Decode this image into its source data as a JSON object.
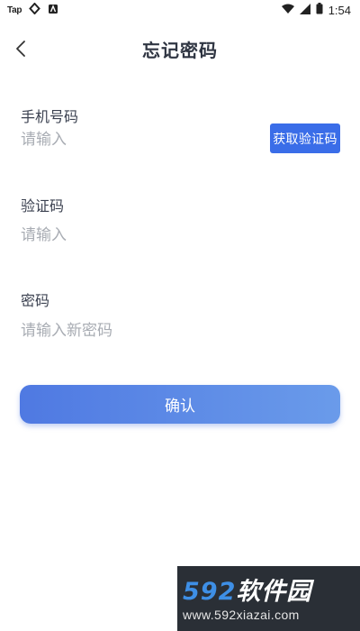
{
  "status_bar": {
    "left_label": "Tap",
    "time": "1:54"
  },
  "header": {
    "title": "忘记密码"
  },
  "form": {
    "phone": {
      "label": "手机号码",
      "placeholder": "请输入"
    },
    "get_code_button": "获取验证码",
    "code": {
      "label": "验证码",
      "placeholder": "请输入"
    },
    "password": {
      "label": "密码",
      "placeholder": "请输入新密码"
    },
    "confirm_button": "确认"
  },
  "watermark": {
    "number": "592",
    "text": "软件园",
    "url": "www.592xiazai.com"
  },
  "colors": {
    "accent": "#3a6de8",
    "button_gradient_start": "#4f79e2",
    "button_gradient_end": "#6a9bea"
  }
}
